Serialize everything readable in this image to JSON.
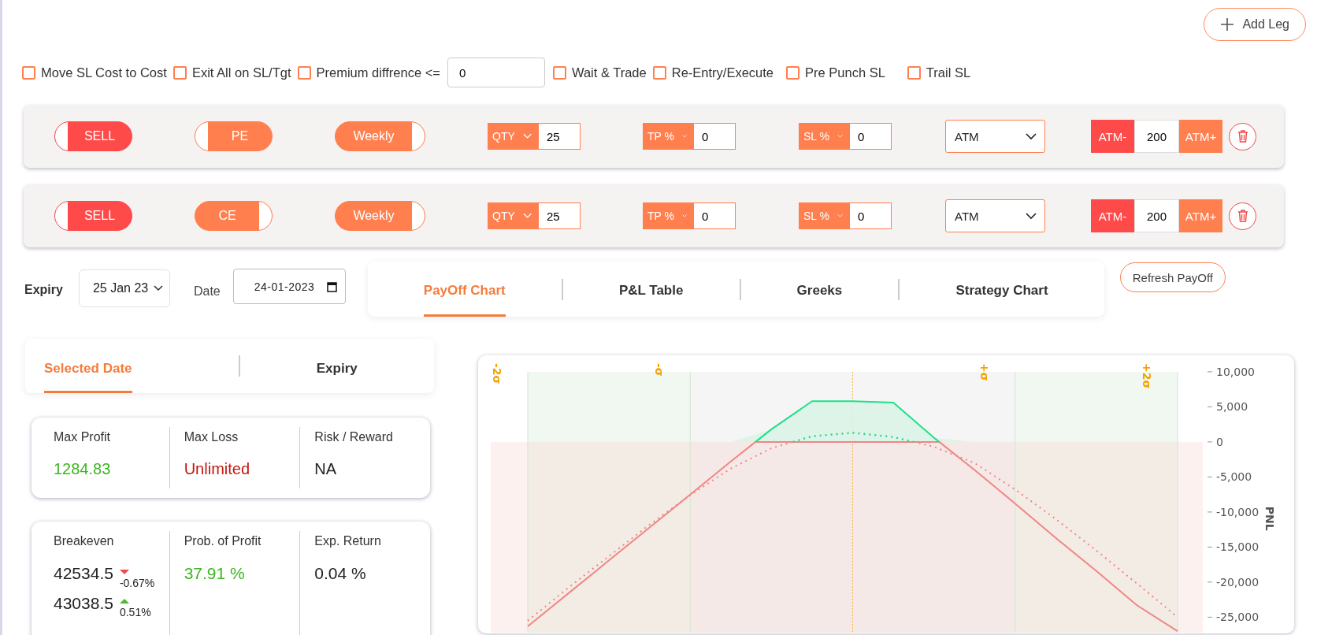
{
  "add_leg_button": "Add Leg",
  "options": [
    {
      "kind": "checkbox",
      "label": "Move SL Cost to Cost",
      "checked": false
    },
    {
      "kind": "checkbox",
      "label": "Exit All on SL/Tgt",
      "checked": false
    },
    {
      "kind": "checkbox_input",
      "label": "Premium diffrence <=",
      "checked": false,
      "value": "0"
    },
    {
      "kind": "checkbox",
      "label": "Wait & Trade",
      "checked": false
    },
    {
      "kind": "checkbox",
      "label": "Re-Entry/Execute",
      "checked": false
    },
    {
      "kind": "checkbox",
      "label": "Pre Punch SL",
      "checked": false
    },
    {
      "kind": "checkbox",
      "label": "Trail SL",
      "checked": false
    }
  ],
  "legs": [
    {
      "toggles": [
        {
          "kind": "side",
          "label": "SELL",
          "on": false
        },
        {
          "kind": "option",
          "label": "PE",
          "on": false
        },
        {
          "kind": "expiry",
          "label": "Weekly",
          "on": true
        }
      ],
      "fields": [
        {
          "mode": "QTY",
          "value": "25"
        },
        {
          "mode": "TP %",
          "value": "0"
        },
        {
          "mode": "SL %",
          "value": "0"
        }
      ],
      "strike": "ATM",
      "stepper": {
        "minus": "ATM-",
        "value": "200",
        "plus": "ATM+"
      }
    },
    {
      "toggles": [
        {
          "kind": "side",
          "label": "SELL",
          "on": false
        },
        {
          "kind": "option",
          "label": "CE",
          "on": true
        },
        {
          "kind": "expiry",
          "label": "Weekly",
          "on": true
        }
      ],
      "fields": [
        {
          "mode": "QTY",
          "value": "25"
        },
        {
          "mode": "TP %",
          "value": "0"
        },
        {
          "mode": "SL %",
          "value": "0"
        }
      ],
      "strike": "ATM",
      "stepper": {
        "minus": "ATM-",
        "value": "200",
        "plus": "ATM+"
      }
    }
  ],
  "expiry": {
    "label": "Expiry",
    "value": "25 Jan 23"
  },
  "date": {
    "label": "Date",
    "value": "24-01-2023"
  },
  "view_tabs": [
    {
      "label": "PayOff Chart",
      "selected": true
    },
    {
      "label": "P&L Table",
      "selected": false
    },
    {
      "label": "Greeks",
      "selected": false
    },
    {
      "label": "Strategy Chart",
      "selected": false
    }
  ],
  "refresh_button": "Refresh PayOff",
  "result_tabs": [
    {
      "label": "Selected Date",
      "selected": true
    },
    {
      "label": "Expiry",
      "selected": false
    }
  ],
  "stats_cards": [
    [
      {
        "label": "Max Profit",
        "values": [
          {
            "value": "1284.83",
            "color": "#3cb521"
          }
        ]
      },
      {
        "label": "Max Loss",
        "values": [
          {
            "value": "Unlimited",
            "color": "#c0180e"
          }
        ]
      },
      {
        "label": "Risk / Reward",
        "values": [
          {
            "value": "NA",
            "color": "#222222"
          }
        ]
      }
    ],
    [
      {
        "label": "Breakeven",
        "values": [
          {
            "value": "42534.5",
            "color": "#222222",
            "change": "-0.67%",
            "up": false
          },
          {
            "value": "43038.5",
            "color": "#222222",
            "change": "0.51%",
            "up": true
          }
        ]
      },
      {
        "label": "Prob. of Profit",
        "values": [
          {
            "value": "37.91 %",
            "color": "#3cb521"
          }
        ]
      },
      {
        "label": "Exp. Return",
        "values": [
          {
            "value": "0.04 %",
            "color": "#222222"
          }
        ]
      }
    ]
  ],
  "chart": {
    "sigma_labels": [
      "-2σ",
      "-σ",
      "+σ",
      "+2σ"
    ],
    "axis_title": "PNL",
    "axis_labels": [
      "10,000",
      "5,000",
      "0",
      "-5,000",
      "-10,000",
      "-15,000",
      "-20,000",
      "-25,000"
    ]
  }
}
